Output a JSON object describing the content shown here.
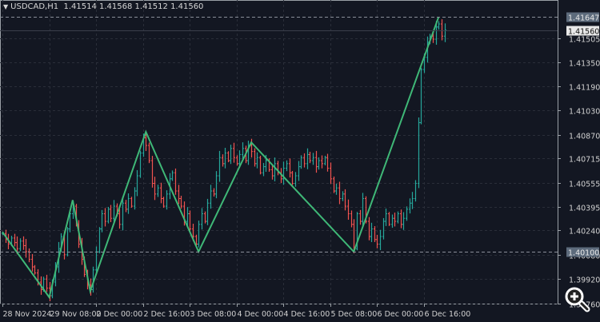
{
  "header": {
    "symbol": "USDCAD,H1",
    "ohlc": "1.41514 1.41568 1.41512 1.41560",
    "menu_icon": "triangle-down-icon"
  },
  "zoom_icon": "zoom-in-magnifier-icon",
  "colors": {
    "background": "#131722",
    "grid": "#2a2e39",
    "bull": "#26a69a",
    "bear": "#ef5350",
    "zigzag": "#3fb877",
    "axis_text": "#d0d0d0",
    "price_label_bg": "#5d6b7c"
  },
  "chart_data": {
    "type": "ohlc-bar",
    "symbol": "USDCAD",
    "timeframe": "H1",
    "ylim": [
      1.39758,
      1.41758
    ],
    "grid": true,
    "y_ticks": [
      "1.41505",
      "1.41350",
      "1.41190",
      "1.41030",
      "1.40870",
      "1.40715",
      "1.40555",
      "1.40395",
      "1.40240",
      "1.40080",
      "1.39920",
      "1.39760"
    ],
    "x_ticks": [
      {
        "bar": 0,
        "label": "28 Nov 2024"
      },
      {
        "bar": 16,
        "label": "29 Nov 08:00"
      },
      {
        "bar": 32,
        "label": "2 Dec 00:00"
      },
      {
        "bar": 48,
        "label": "2 Dec 16:00"
      },
      {
        "bar": 64,
        "label": "3 Dec 08:00"
      },
      {
        "bar": 80,
        "label": "4 Dec 00:00"
      },
      {
        "bar": 96,
        "label": "4 Dec 16:00"
      },
      {
        "bar": 112,
        "label": "5 Dec 08:00"
      },
      {
        "bar": 128,
        "label": "6 Dec 00:00"
      },
      {
        "bar": 144,
        "label": "6 Dec 16:00"
      }
    ],
    "close": [
      1.4022,
      1.4018,
      1.4015,
      1.4019,
      1.4016,
      1.4012,
      1.4017,
      1.4014,
      1.401,
      1.4005,
      1.4,
      1.3996,
      1.399,
      1.3985,
      1.3992,
      1.3986,
      1.3981,
      1.399,
      1.4,
      1.4012,
      1.402,
      1.4008,
      1.4025,
      1.4035,
      1.404,
      1.4028,
      1.4015,
      1.4005,
      1.3995,
      1.3988,
      1.3985,
      1.3998,
      1.401,
      1.4025,
      1.4035,
      1.403,
      1.4038,
      1.4032,
      1.404,
      1.4035,
      1.4028,
      1.4042,
      1.4038,
      1.4045,
      1.404,
      1.405,
      1.406,
      1.4075,
      1.4085,
      1.408,
      1.407,
      1.4055,
      1.4048,
      1.4052,
      1.4045,
      1.404,
      1.4048,
      1.4058,
      1.4062,
      1.405,
      1.4045,
      1.404,
      1.403,
      1.4035,
      1.4025,
      1.402,
      1.4015,
      1.4028,
      1.4035,
      1.403,
      1.4042,
      1.405,
      1.4048,
      1.406,
      1.4072,
      1.4068,
      1.4075,
      1.407,
      1.4078,
      1.4072,
      1.4068,
      1.4074,
      1.4078,
      1.407,
      1.408,
      1.4076,
      1.4068,
      1.4072,
      1.4062,
      1.4066,
      1.407,
      1.4064,
      1.406,
      1.4068,
      1.4062,
      1.4058,
      1.4065,
      1.4068,
      1.4062,
      1.4055,
      1.406,
      1.4066,
      1.4072,
      1.4068,
      1.4074,
      1.407,
      1.4072,
      1.4066,
      1.407,
      1.4068,
      1.4072,
      1.4065,
      1.4058,
      1.405,
      1.4052,
      1.4045,
      1.4048,
      1.404,
      1.4035,
      1.4028,
      1.4012,
      1.4035,
      1.403,
      1.4045,
      1.403,
      1.402,
      1.4025,
      1.4018,
      1.4015,
      1.402,
      1.403,
      1.4035,
      1.4028,
      1.4032,
      1.403,
      1.4035,
      1.4028,
      1.4032,
      1.4038,
      1.4042,
      1.4045,
      1.4055,
      1.4095,
      1.413,
      1.4138,
      1.4148,
      1.4152,
      1.415,
      1.4158,
      1.416,
      1.4152,
      1.4156
    ],
    "zigzag": [
      {
        "bar": 0,
        "price": 1.4023
      },
      {
        "bar": 16,
        "price": 1.398
      },
      {
        "bar": 24,
        "price": 1.4044
      },
      {
        "bar": 30,
        "price": 1.3984
      },
      {
        "bar": 49,
        "price": 1.4089
      },
      {
        "bar": 67,
        "price": 1.401
      },
      {
        "bar": 85,
        "price": 1.4082
      },
      {
        "bar": 120,
        "price": 1.401
      },
      {
        "bar": 149,
        "price": 1.41647
      }
    ],
    "price_lines": [
      {
        "price": 1.41647,
        "label": "1.41647",
        "style": "dashed"
      },
      {
        "price": 1.4156,
        "label": "1.41560",
        "style": "bid"
      },
      {
        "price": 1.401,
        "label": "1.40100",
        "style": "dashed"
      }
    ]
  }
}
